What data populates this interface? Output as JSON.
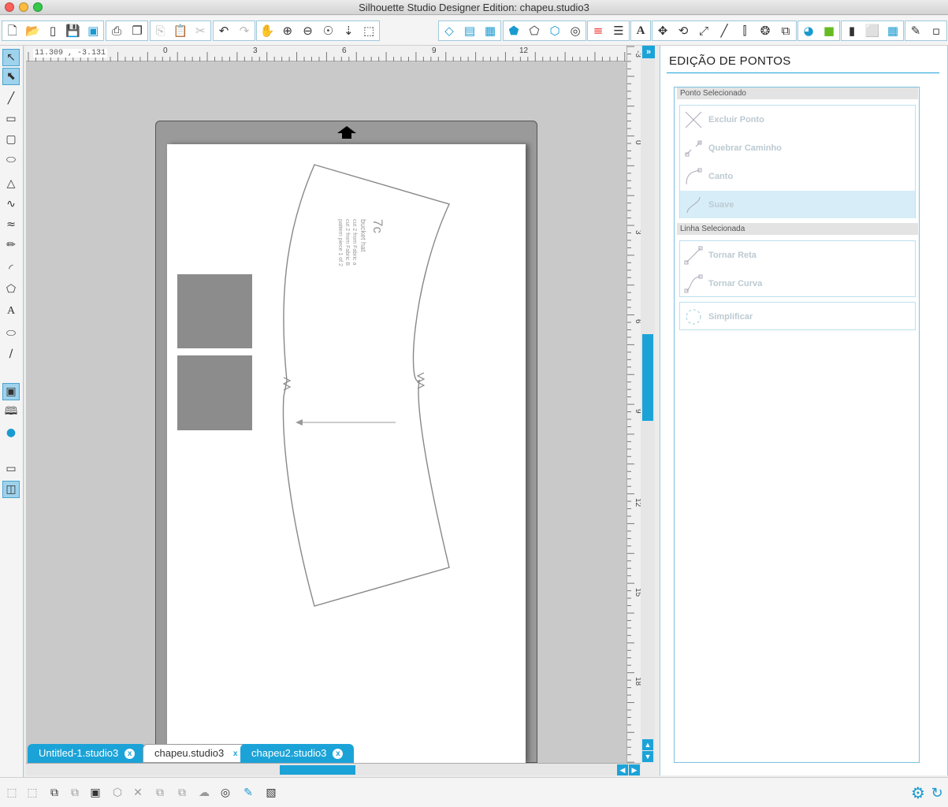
{
  "window": {
    "title": "Silhouette Studio Designer Edition: chapeu.studio3"
  },
  "coords": "11.309 , -3.131",
  "ruler": {
    "top_ticks": [
      "0",
      "3",
      "6",
      "9",
      "12"
    ],
    "right_ticks": [
      "-3",
      "0",
      "3",
      "6",
      "9",
      "12",
      "15",
      "18"
    ]
  },
  "toolbar": {
    "icons": [
      "new-file-icon",
      "open-icon",
      "new-window-icon",
      "save-icon",
      "save-library-icon",
      "print-icon",
      "send-to-cutter-icon",
      "copy-icon",
      "paste-icon",
      "cut-icon",
      "undo-icon",
      "redo-icon",
      "pan-icon",
      "zoom-in-icon",
      "zoom-out-icon",
      "zoom-select-icon",
      "drag-zoom-icon",
      "fit-page-icon",
      "page-settings-icon",
      "grid-icon",
      "fill-color-icon",
      "line-color-icon",
      "gradient-icon",
      "pattern-icon",
      "shadow-icon",
      "line-style-icon",
      "line-weight-icon",
      "text-icon",
      "transform-icon",
      "rotate-icon",
      "scale-icon",
      "shear-icon",
      "align-icon",
      "replicate-icon",
      "offset-icon",
      "trace-icon",
      "design-store-icon",
      "library-icon",
      "send-panel-icon",
      "settings-panel-icon"
    ]
  },
  "design": {
    "label_code": "7c",
    "label_name": "bucket hat",
    "label_line1": "cut 2 from Fabric a",
    "label_line2": "cut 2 from Fabric B",
    "label_line3": "pattern piece 1 of 2"
  },
  "tabs": [
    {
      "label": "Untitled-1.studio3",
      "close": "x"
    },
    {
      "label": "chapeu.studio3",
      "close": "x"
    },
    {
      "label": "chapeu2.studio3",
      "close": "x"
    }
  ],
  "panel": {
    "title": "EDIÇÃO DE PONTOS",
    "point_section": "Ponto Selecionado",
    "line_section": "Linha Selecionada",
    "point_items": [
      {
        "label": "Excluir Ponto",
        "icon": "delete-point-icon"
      },
      {
        "label": "Quebrar Caminho",
        "icon": "break-path-icon"
      },
      {
        "label": "Canto",
        "icon": "corner-icon"
      },
      {
        "label": "Suave",
        "icon": "smooth-icon"
      }
    ],
    "line_items": [
      {
        "label": "Tornar Reta",
        "icon": "make-straight-icon"
      },
      {
        "label": "Tornar Curva",
        "icon": "make-curve-icon"
      }
    ],
    "simplify": {
      "label": "Simplificar",
      "icon": "simplify-icon"
    }
  },
  "colors": {
    "accent": "#1ba3d8",
    "mat": "#9a9a9a",
    "canvas": "#c9c9c9"
  }
}
